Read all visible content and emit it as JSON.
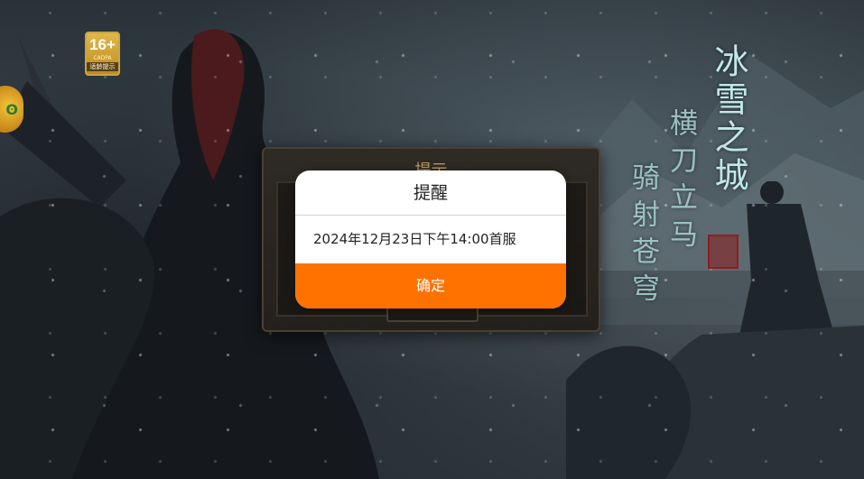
{
  "background": {
    "age_badge": {
      "rating": "16+",
      "org": "CADPA",
      "tip": "适龄提示"
    },
    "calligraphy": {
      "title": "冰雪之城",
      "poem_line1": "横刀立马",
      "poem_line2": "骑射苍穹"
    },
    "back_panel_title": "提示"
  },
  "dialog": {
    "title": "提醒",
    "message": "2024年12月23日下午14:00首服",
    "confirm_label": "确定",
    "confirm_color": "#ff7200"
  },
  "icons": [
    "game-side-icon",
    "age-rating-badge",
    "seal-icon"
  ]
}
